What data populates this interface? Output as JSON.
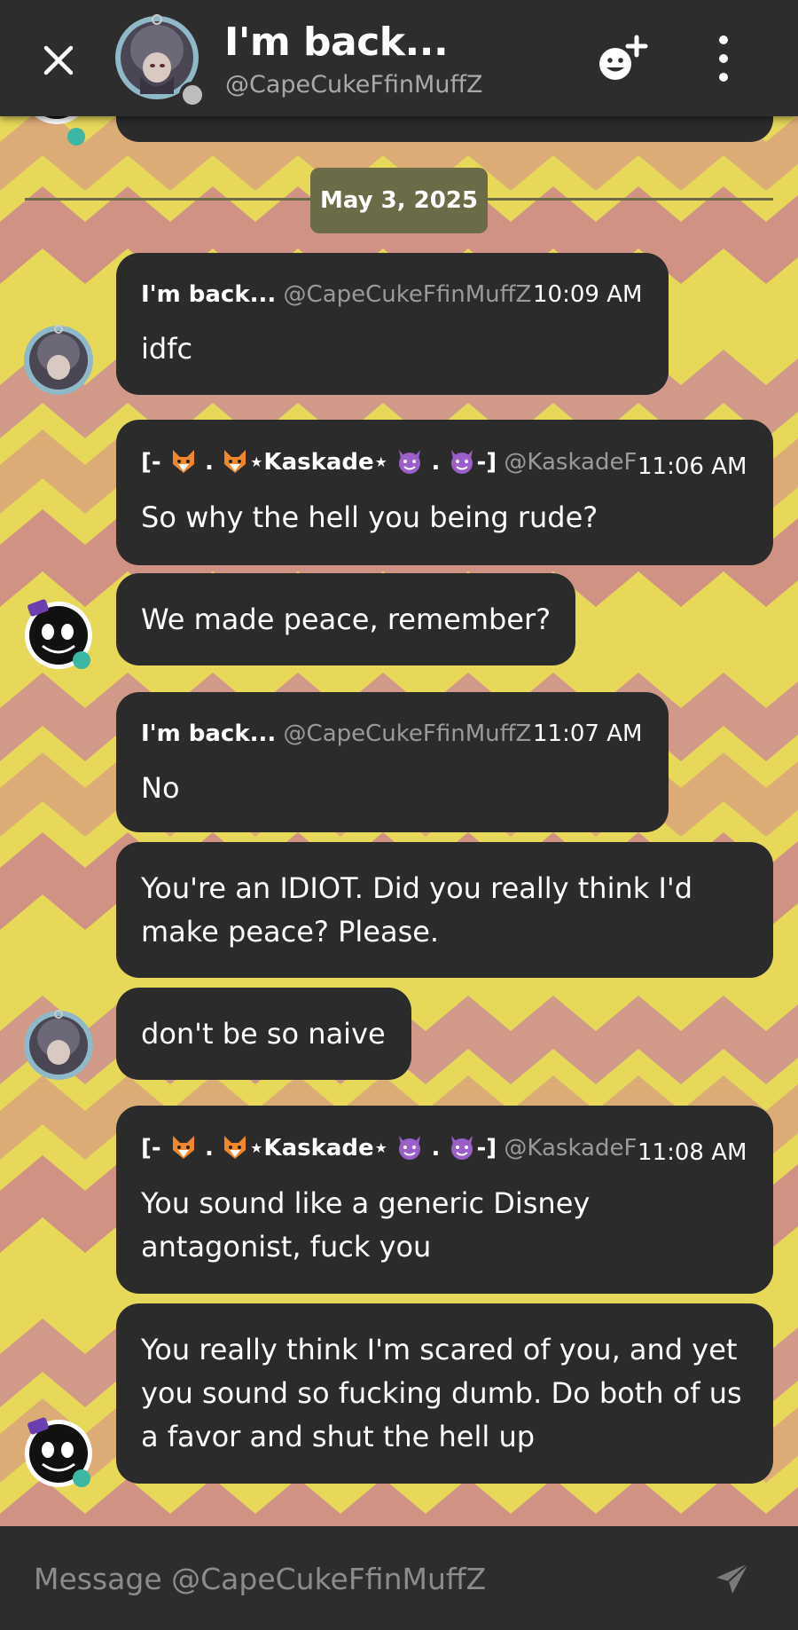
{
  "header": {
    "title": "I'm back...",
    "handle": "@CapeCukeFfinMuffZ"
  },
  "date_divider": "May 3, 2025",
  "messages": [
    {
      "name": "I'm back...",
      "handle": "@CapeCukeFfinMuffZ",
      "time": "10:09 AM",
      "text": "idfc"
    },
    {
      "name_prefix": "[- ",
      "name_mid": " .",
      "name_core": "⋆Kaskade⋆",
      "name_dot": ". ",
      "name_suffix": "-]",
      "handle": "@KaskadeF",
      "time": "11:06 AM",
      "text": "So why the hell you being rude?"
    },
    {
      "text": "We made peace, remember?"
    },
    {
      "name": "I'm back...",
      "handle": "@CapeCukeFfinMuffZ",
      "time": "11:07 AM",
      "text": "No"
    },
    {
      "text_line1": "You're an IDIOT. Did you really think I'd",
      "text_line2": "make peace? Please."
    },
    {
      "text": "don't be so naive"
    },
    {
      "name_prefix": "[- ",
      "name_mid": " .",
      "name_core": "⋆Kaskade⋆",
      "name_dot": ". ",
      "name_suffix": "-]",
      "handle": "@KaskadeF",
      "time": "11:08 AM",
      "text_line1": "You sound like a generic Disney",
      "text_line2": "antagonist, fuck you"
    },
    {
      "text_line1": "You really think I'm scared of you, and yet",
      "text_line2": "you sound so fucking dumb. Do both of us",
      "text_line3": "a favor and shut the hell up"
    }
  ],
  "composer": {
    "placeholder": "Message @CapeCukeFfinMuffZ"
  },
  "icons": {
    "close": "close-icon",
    "add_reaction": "add-emoji-icon",
    "more": "more-vertical-icon",
    "send": "send-icon"
  },
  "colors": {
    "bar": "#2d2d2d",
    "bubble": "#2b2b2b",
    "bg_yellow": "#e7d85a",
    "bg_pink": "#c97a87",
    "date_pill": "#6b6b47"
  }
}
